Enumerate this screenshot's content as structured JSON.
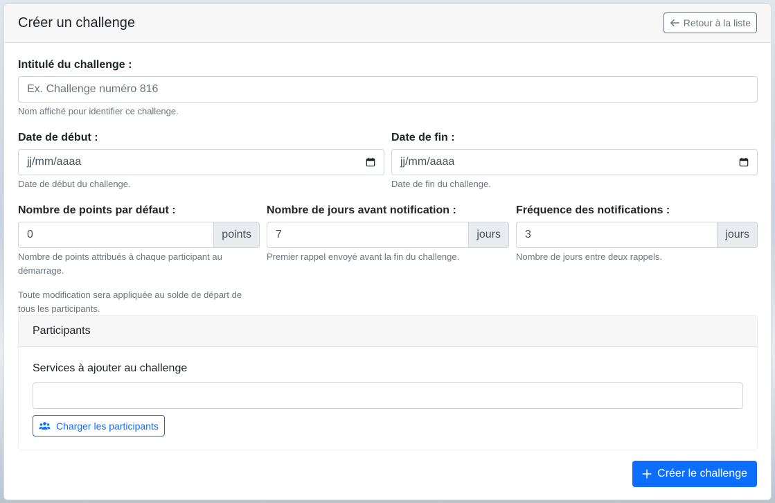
{
  "header": {
    "title": "Créer un challenge",
    "back_label": "Retour à la liste"
  },
  "title_field": {
    "label": "Intitulé du challenge :",
    "placeholder": "Ex. Challenge numéro 816",
    "help": "Nom affiché pour identifier ce challenge."
  },
  "start_date": {
    "label": "Date de début :",
    "value": "jj/mm/aaaa",
    "help": "Date de début du challenge."
  },
  "end_date": {
    "label": "Date de fin :",
    "value": "jj/mm/aaaa",
    "help": "Date de fin du challenge."
  },
  "points": {
    "label": "Nombre de points par défaut :",
    "value": "0",
    "addon": "points",
    "help_line1": "Nombre de points attribués à chaque participant au",
    "help_line2": "démarrage.",
    "note_line1": "Toute modification sera appliquée au solde de départ de",
    "note_line2": "tous les participants."
  },
  "notify_days": {
    "label": "Nombre de jours avant notification :",
    "value": "7",
    "addon": "jours",
    "help": "Premier rappel envoyé avant la fin du challenge."
  },
  "frequency": {
    "label": "Fréquence des notifications :",
    "value": "3",
    "addon": "jours",
    "help": "Nombre de jours entre deux rappels."
  },
  "participants": {
    "title": "Participants",
    "services_label": "Services à ajouter au challenge",
    "services_value": "",
    "load_label": "Charger les participants"
  },
  "submit_label": "Créer le challenge",
  "icons": {
    "back": "arrow-left-icon",
    "calendar": "calendar-icon",
    "users": "users-icon",
    "plus": "plus-icon"
  },
  "colors": {
    "primary": "#0d6efd",
    "secondary": "#6c757d",
    "addon_bg": "#e9ecef"
  }
}
